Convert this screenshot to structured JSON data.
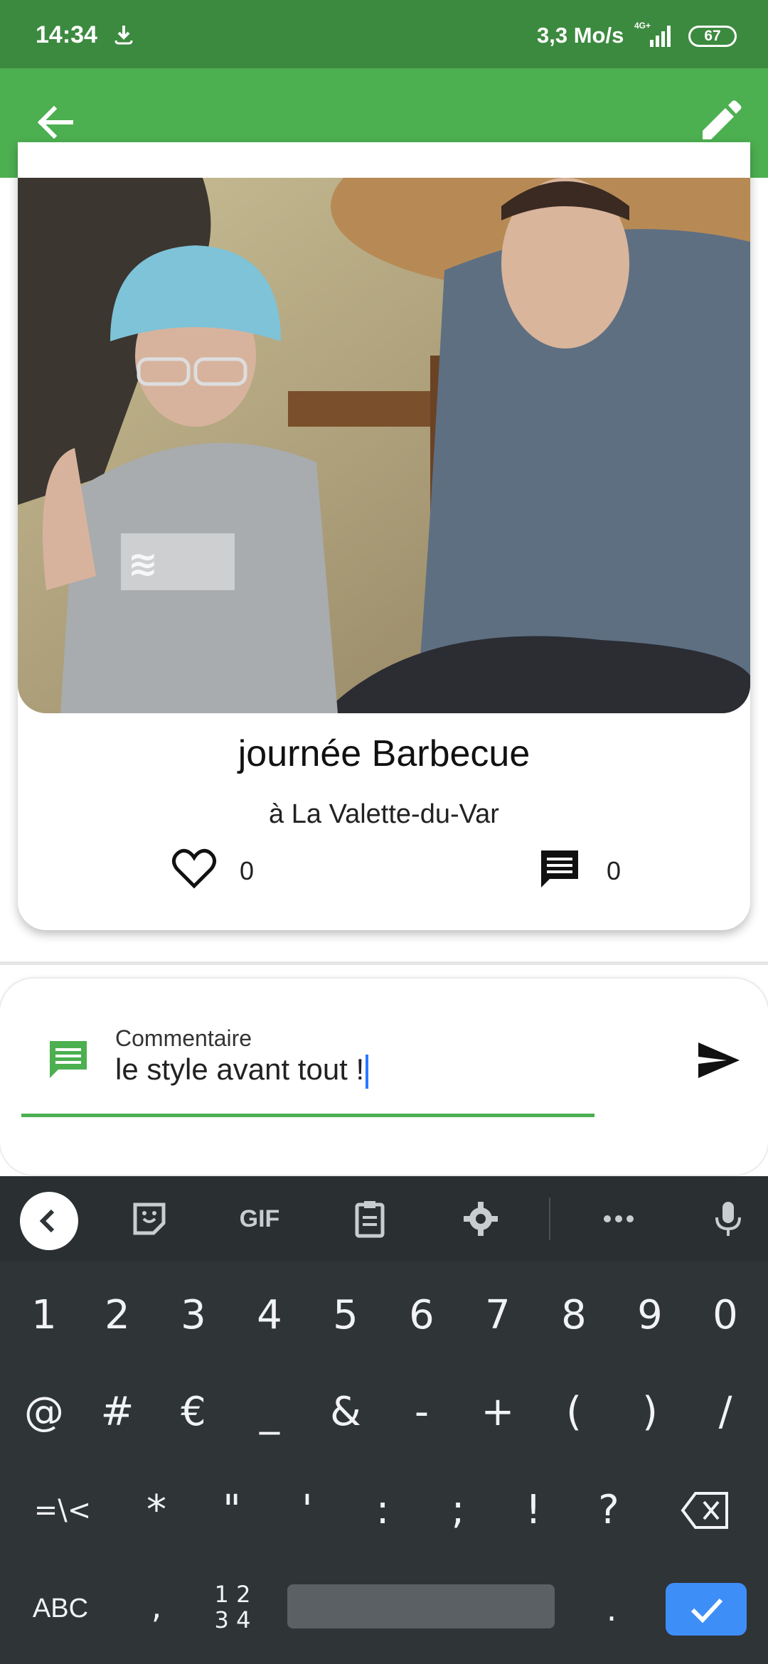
{
  "status_bar": {
    "time": "14:34",
    "speed": "3,3 Mo/s",
    "network": "4G+",
    "battery": "67"
  },
  "app_bar": {
    "back_icon": "arrow-left-icon",
    "edit_icon": "pencil-icon",
    "color": "#4caf50"
  },
  "post": {
    "title": "journée Barbecue",
    "location": "à La Valette-du-Var",
    "likes": "0",
    "comments": "0"
  },
  "composer": {
    "label": "Commentaire",
    "value": "le style avant tout !",
    "accent": "#4caf50"
  },
  "keyboard": {
    "toolbar": {
      "gif": "GIF"
    },
    "row1": [
      "1",
      "2",
      "3",
      "4",
      "5",
      "6",
      "7",
      "8",
      "9",
      "0"
    ],
    "row2": [
      "@",
      "#",
      "€",
      "_",
      "&",
      "-",
      "+",
      "(",
      ")",
      "/"
    ],
    "row3": [
      "=\\<",
      "*",
      "\"",
      "'",
      ":",
      ";",
      "!",
      "?"
    ],
    "abc": "ABC",
    "comma": ",",
    "numpad_top": "1 2",
    "numpad_bottom": "3 4",
    "period": "."
  }
}
